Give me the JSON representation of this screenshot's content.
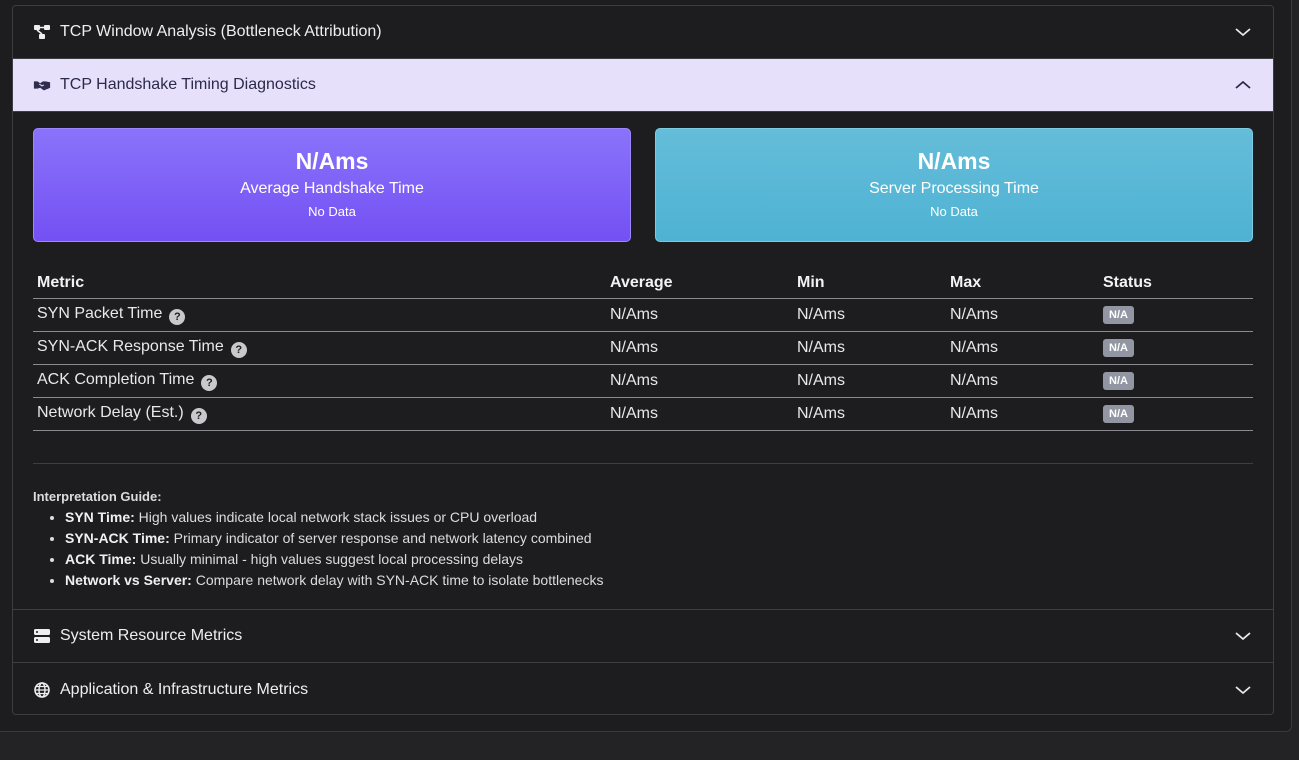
{
  "sections": {
    "tcp_window": {
      "title": "TCP Window Analysis (Bottleneck Attribution)",
      "icon": "network-nodes-icon"
    },
    "handshake": {
      "title": "TCP Handshake Timing Diagnostics",
      "icon": "handshake-icon"
    },
    "system": {
      "title": "System Resource Metrics",
      "icon": "server-icon"
    },
    "app": {
      "title": "Application & Infrastructure Metrics",
      "icon": "globe-icon"
    }
  },
  "cards": {
    "avg_handshake": {
      "value": "N/Ams",
      "label": "Average Handshake Time",
      "sub": "No Data",
      "color": "#7a5cf6"
    },
    "server_processing": {
      "value": "N/Ams",
      "label": "Server Processing Time",
      "sub": "No Data",
      "color": "#58b8d6"
    }
  },
  "table": {
    "headers": [
      "Metric",
      "Average",
      "Min",
      "Max",
      "Status"
    ],
    "rows": [
      {
        "metric": "SYN Packet Time",
        "avg": "N/Ams",
        "min": "N/Ams",
        "max": "N/Ams",
        "status": "N/A"
      },
      {
        "metric": "SYN-ACK Response Time",
        "avg": "N/Ams",
        "min": "N/Ams",
        "max": "N/Ams",
        "status": "N/A"
      },
      {
        "metric": "ACK Completion Time",
        "avg": "N/Ams",
        "min": "N/Ams",
        "max": "N/Ams",
        "status": "N/A"
      },
      {
        "metric": "Network Delay (Est.)",
        "avg": "N/Ams",
        "min": "N/Ams",
        "max": "N/Ams",
        "status": "N/A"
      }
    ]
  },
  "guide": {
    "title": "Interpretation Guide:",
    "items": [
      {
        "term": "SYN Time:",
        "text": " High values indicate local network stack issues or CPU overload"
      },
      {
        "term": "SYN-ACK Time:",
        "text": " Primary indicator of server response and network latency combined"
      },
      {
        "term": "ACK Time:",
        "text": " Usually minimal - high values suggest local processing delays"
      },
      {
        "term": "Network vs Server:",
        "text": " Compare network delay with SYN-ACK time to isolate bottlenecks"
      }
    ]
  },
  "help_glyph": "?"
}
